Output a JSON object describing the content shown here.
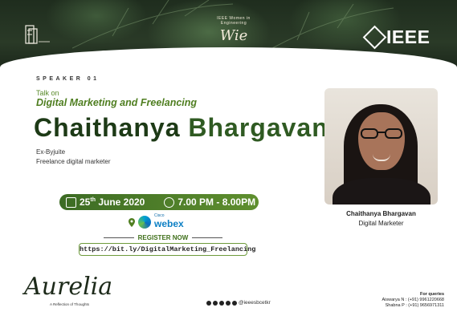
{
  "header": {
    "logo_left": "e-cell-logo",
    "logo_mid_small": "IEEE Women in Engineering",
    "logo_mid_main": "Wie",
    "ieee": "IEEE"
  },
  "speaker": {
    "tag": "SPEAKER 01",
    "talk_on": "Talk on",
    "talk_title": "Digital Marketing and Freelancing",
    "name_first": "Chaithanya",
    "name_last": "Bhargavan",
    "role1": "Ex-Byjuite",
    "role2": "Freelance digital marketer"
  },
  "event": {
    "date_day": "25",
    "date_sup": "th",
    "date_rest": "June 2020",
    "time": "7.00 PM - 8.00PM",
    "platform_cisco": "Cisco",
    "platform": "webex",
    "register_label": "REGISTER NOW",
    "register_url": "https://bit.ly/DigitalMarketing_Freelancing"
  },
  "photo_caption": {
    "name": "Chaithanya Bhargavan",
    "role": "Digital Marketer"
  },
  "footer": {
    "brand": "Aurelia",
    "brand_sub": "A Reflection of Thoughts",
    "social_handle": "@ieeesbcetkr",
    "queries_title": "For queries",
    "contact1": "Aiswarya N : (+91) 9961220668",
    "contact2": "Shabna P : (+91) 9656971311"
  },
  "colors": {
    "accent_green": "#4f7e20",
    "name_green": "#1d3a16",
    "band_dark": "#1f2d1e"
  }
}
